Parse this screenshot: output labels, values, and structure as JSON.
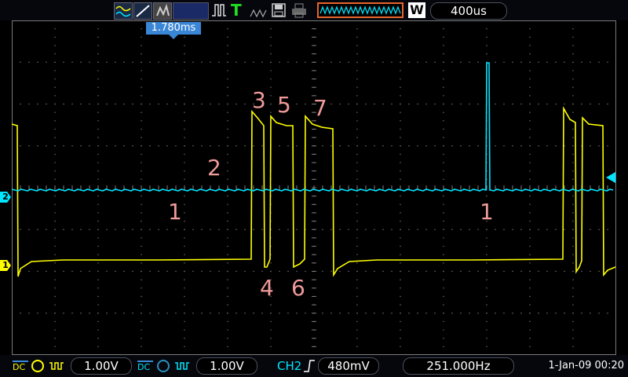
{
  "toolbar": {
    "icons": [
      "waveform-icon",
      "trigger-edge-icon",
      "persistence-icon",
      "run-mode-icon",
      "pulse-trigger-icon",
      "trigger-mode-icon",
      "save-icon",
      "print-icon",
      "memory-depth-icon",
      "wide-mode-icon"
    ],
    "timebase": "400us",
    "wide_mode_label": "W",
    "trigger_position": "1.780ms"
  },
  "colors": {
    "ch1": "#ffff00",
    "ch2": "#00e5ff",
    "grid": "#7a7a7a",
    "annotation": "#f09a9a"
  },
  "markers": {
    "ch1": "1",
    "ch2": "2"
  },
  "annotations": [
    "1",
    "2",
    "3",
    "4",
    "5",
    "6",
    "7",
    "1"
  ],
  "bottombar": {
    "ch1": {
      "coupling": "DC",
      "scale": "1.00V"
    },
    "ch2": {
      "coupling": "DC",
      "scale": "1.00V"
    },
    "trigger": {
      "source": "CH2",
      "level": "480mV"
    },
    "frequency": "251.000Hz",
    "datetime": "1-Jan-09 00:20"
  }
}
